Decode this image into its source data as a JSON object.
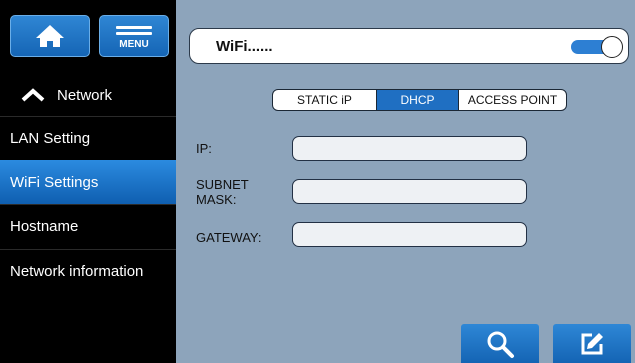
{
  "sidebar": {
    "network_label": "Network",
    "items": [
      {
        "label": "LAN Setting"
      },
      {
        "label": "WiFi Settings"
      },
      {
        "label": "Hostname"
      },
      {
        "label": "Network information"
      }
    ],
    "menu_label": "MENU"
  },
  "wifi": {
    "label": "WiFi......",
    "enabled": true
  },
  "modes": {
    "options": [
      "STATIC iP",
      "DHCP",
      "ACCESS POINT"
    ],
    "selected": "DHCP"
  },
  "fields": {
    "ip_label": "IP:",
    "subnet_label_line1": "SUBNET",
    "subnet_label_line2": "MASK:",
    "gateway_label": "GATEWAY:",
    "ip_value": "",
    "subnet_value": "",
    "gateway_value": ""
  },
  "colors": {
    "accent": "#1f6fc2",
    "background": "#8da4bb",
    "sidebar": "#000000"
  },
  "icons": {
    "home": "home-icon",
    "menu": "menu-icon",
    "network": "chevron-up-icon",
    "search": "search-icon",
    "edit": "edit-icon"
  }
}
